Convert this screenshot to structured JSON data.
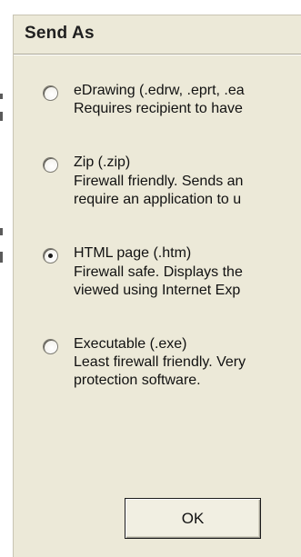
{
  "dialog": {
    "title": "Send As"
  },
  "options": [
    {
      "label": "eDrawing (.edrw, .eprt, .ea",
      "lines": [
        "Requires recipient to have"
      ],
      "selected": false
    },
    {
      "label": "Zip (.zip)",
      "lines": [
        "Firewall friendly. Sends an",
        "require an application to u"
      ],
      "selected": false
    },
    {
      "label": "HTML page (.htm)",
      "lines": [
        "Firewall safe. Displays the",
        "viewed using Internet Exp"
      ],
      "selected": true
    },
    {
      "label": "Executable (.exe)",
      "lines": [
        "Least firewall friendly. Very",
        "protection software."
      ],
      "selected": false
    }
  ],
  "buttons": {
    "ok_label": "OK"
  },
  "colors": {
    "dialog_bg": "#ece9d8",
    "text": "#111111"
  }
}
